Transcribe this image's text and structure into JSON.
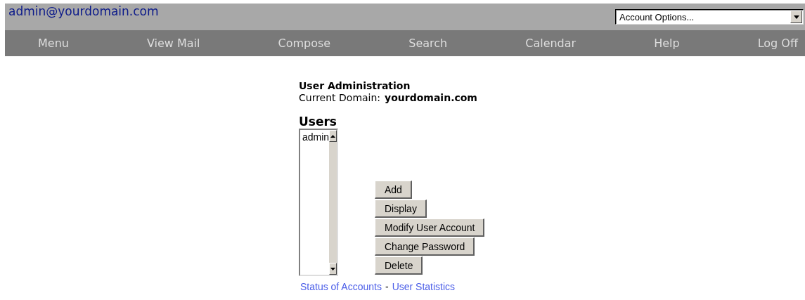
{
  "header": {
    "account": "admin@yourdomain.com",
    "options_dropdown": {
      "value": "Account Options..."
    }
  },
  "nav": [
    "Menu",
    "View Mail",
    "Compose",
    "Search",
    "Calendar",
    "Help",
    "Log Off"
  ],
  "panel": {
    "title": "User Administration",
    "domain_label": "Current Domain:",
    "domain": "yourdomain.com",
    "users_heading": "Users",
    "users": [
      "admin"
    ],
    "buttons": [
      "Add",
      "Display",
      "Modify User Account",
      "Change Password",
      "Delete"
    ],
    "links": [
      "Status of Accounts",
      "User Statistics"
    ],
    "link_separator": "-"
  }
}
